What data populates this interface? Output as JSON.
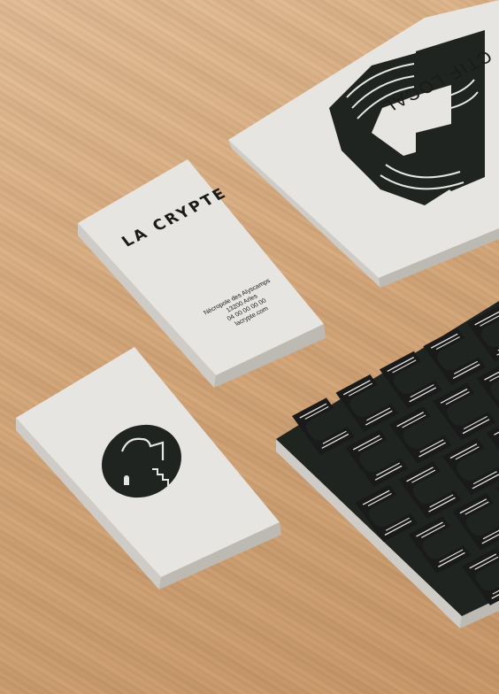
{
  "scene": {
    "brand_name": "LA CRYPTE",
    "address_lines": [
      "Nécropole des Alyscamps",
      "13200 Arles",
      "04 00 00 00 00",
      "lacrypte.com"
    ],
    "motto_fragment": "CTIF LOCAL",
    "icon": "crypt-stairs-circle-icon",
    "pattern_icon": "stacked-c-monogram-icon",
    "colors": {
      "wood": "#d7ab7e",
      "paper": "#e7e5e1",
      "ink_dark": "#1f2420",
      "ink_black": "#1a1a1a"
    }
  }
}
